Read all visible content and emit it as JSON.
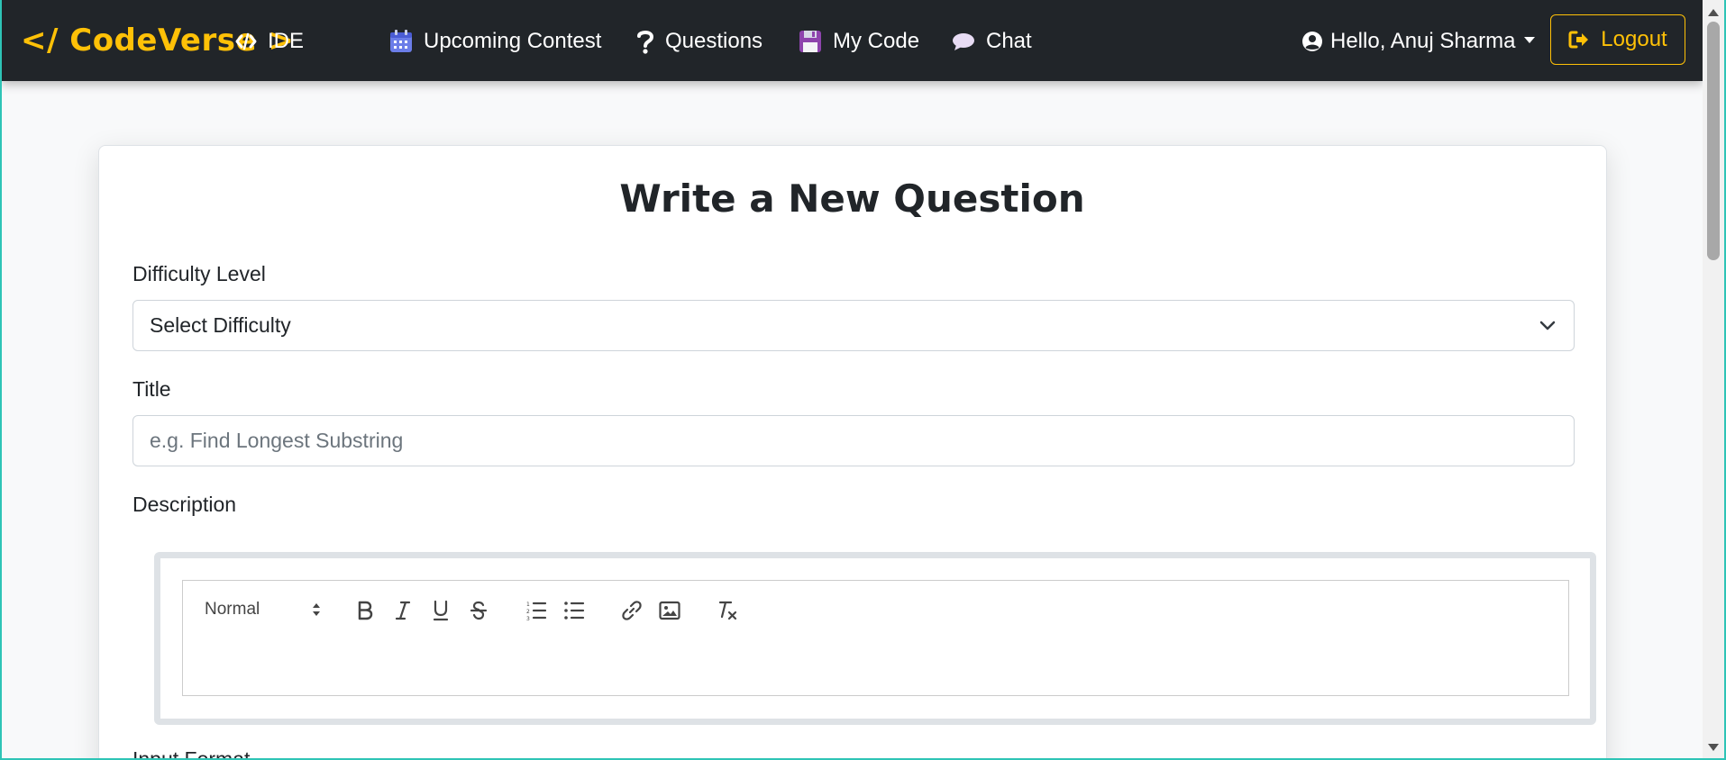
{
  "navbar": {
    "brand": "</ CodeVerse >",
    "items": [
      {
        "label": "IDE",
        "icon": "code-icon"
      },
      {
        "label": "Upcoming Contest",
        "icon": "calendar-icon"
      },
      {
        "label": "Questions",
        "icon": "question-icon"
      },
      {
        "label": "My Code",
        "icon": "floppy-disk-icon"
      },
      {
        "label": "Chat",
        "icon": "chat-bubble-icon"
      }
    ],
    "user_greeting": "Hello, Anuj Sharma",
    "logout_label": "Logout",
    "colors": {
      "background": "#212529",
      "brand": "#ffc107",
      "text": "#ffffff"
    }
  },
  "form": {
    "title": "Write a New Question",
    "difficulty": {
      "label": "Difficulty Level",
      "selected": "Select Difficulty"
    },
    "title_field": {
      "label": "Title",
      "placeholder": "e.g. Find Longest Substring",
      "value": ""
    },
    "description": {
      "label": "Description",
      "toolbar": {
        "header_select": "Normal",
        "buttons": [
          "bold-icon",
          "italic-icon",
          "underline-icon",
          "strikethrough-icon",
          "ordered-list-icon",
          "bullet-list-icon",
          "link-icon",
          "image-icon",
          "clear-format-icon"
        ]
      }
    },
    "next_label": "Input Format"
  }
}
